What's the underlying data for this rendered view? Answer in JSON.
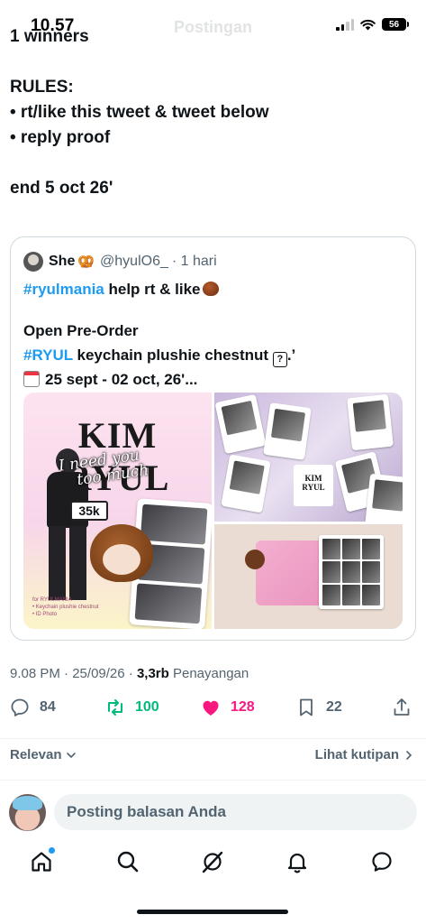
{
  "status": {
    "time": "10.57",
    "battery": "56"
  },
  "header": {
    "title": "Postingan"
  },
  "tweet": {
    "lines": [
      "1 winners",
      "RULES:",
      "• rt/like this tweet & tweet below",
      "• reply proof",
      "end 5 oct 26'"
    ]
  },
  "quote": {
    "name": "She",
    "handle": "@hyulO6_",
    "time": "· 1 hari",
    "line1_hashtag": "#ryulmania",
    "line1_text": " help rt & like",
    "line2": "Open Pre-Order",
    "line3_hashtag": "#RYUL",
    "line3_text": " keychain plushie chestnut ",
    "line3_symbol": "?",
    "line3_tail": ".ʼ",
    "line4": "25 sept - 02 oct, 26'...",
    "media_left": {
      "title": "KIM RYUL",
      "handwriting_line1": "I need you",
      "handwriting_line2": "too much",
      "price": "35k",
      "footer_1": "for RYULMANIA",
      "footer_2": "• Keychain plushie chestnut",
      "footer_3": "• ID Photo"
    },
    "media_top_right": {
      "sticker_title": "KIM RYUL"
    }
  },
  "meta": {
    "time": "9.08 PM",
    "sep1": " · ",
    "date": "25/09/26",
    "sep2": " · ",
    "views": "3,3rb",
    "views_label": " Penayangan"
  },
  "actions": {
    "replies": "84",
    "reposts": "100",
    "likes": "128",
    "bookmarks": "22"
  },
  "filters": {
    "sort_label": "Relevan",
    "quotes_label": "Lihat kutipan"
  },
  "reply": {
    "placeholder": "Posting balasan Anda"
  },
  "colors": {
    "accent": "#1d9bf0",
    "repost": "#00ba7c",
    "like": "#f91880",
    "muted": "#536471"
  }
}
